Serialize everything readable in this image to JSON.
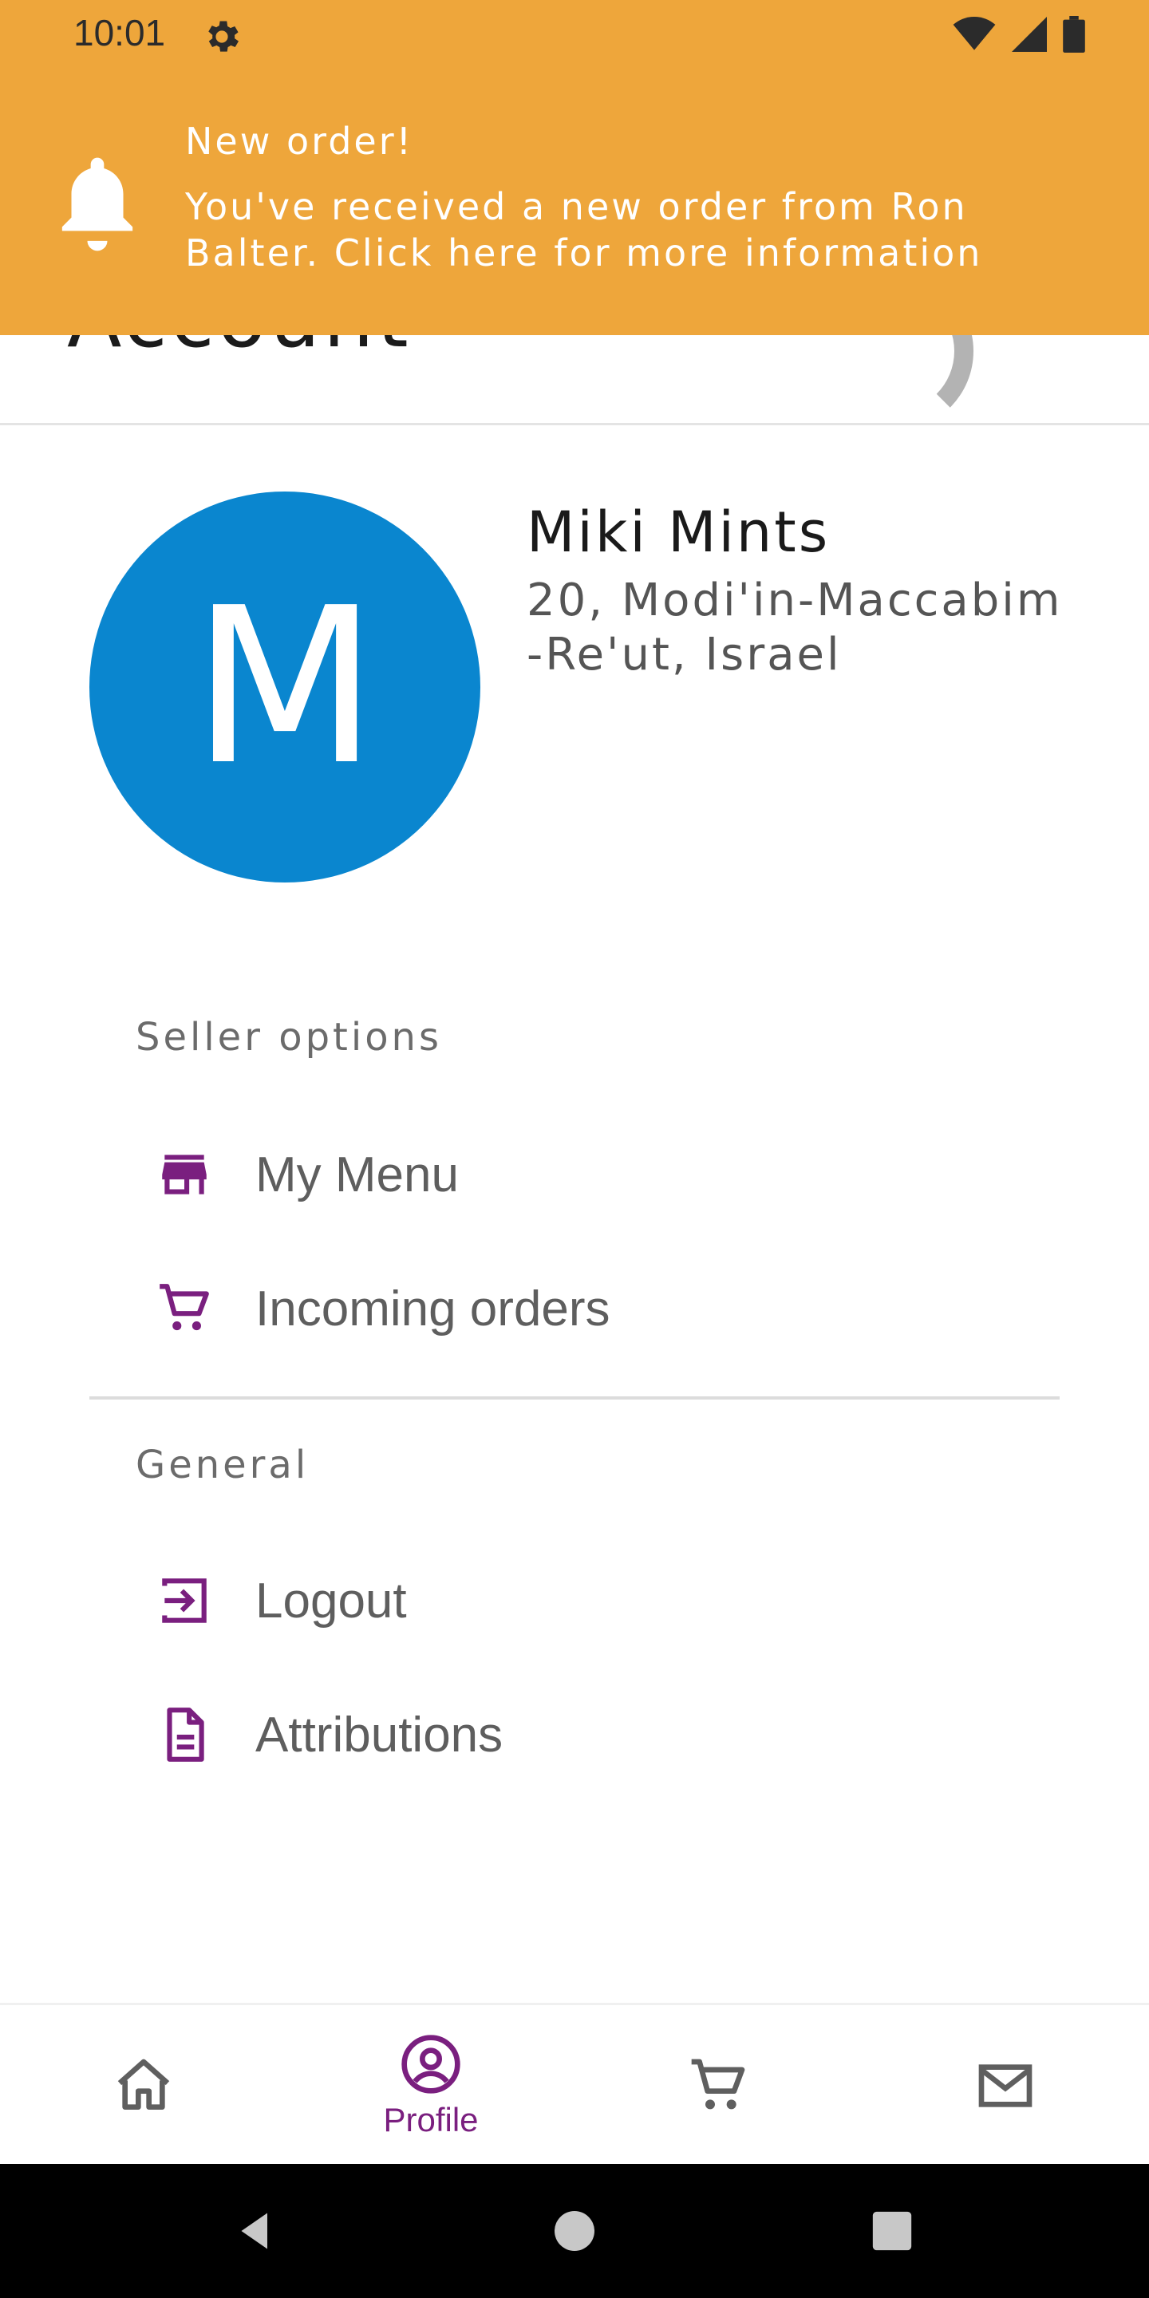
{
  "status_bar": {
    "time": "10:01",
    "icons": [
      "gear-icon",
      "wifi-icon",
      "signal-icon",
      "battery-icon"
    ]
  },
  "notification": {
    "title": "New order!",
    "body": "You've received a new order from Ron Balter. Click here for more information",
    "icon": "bell-icon",
    "background_color": "#eea63b"
  },
  "header": {
    "title": "Account"
  },
  "profile": {
    "initial": "M",
    "name": "Miki Mints",
    "address": "20, Modi'in-Maccabim-Re'ut, Israel",
    "avatar_color": "#0a86cf"
  },
  "seller_section": {
    "title": "Seller options",
    "items": [
      {
        "label": "My Menu",
        "icon": "store-icon"
      },
      {
        "label": "Incoming orders",
        "icon": "cart-icon"
      }
    ]
  },
  "general_section": {
    "title": "General",
    "items": [
      {
        "label": "Logout",
        "icon": "logout-icon"
      },
      {
        "label": "Attributions",
        "icon": "document-icon"
      }
    ]
  },
  "bottom_nav": {
    "items": [
      {
        "id": "home",
        "icon": "home-icon",
        "label": ""
      },
      {
        "id": "profile",
        "icon": "profile-icon",
        "label": "Profile",
        "active": true
      },
      {
        "id": "cart",
        "icon": "cart-icon",
        "label": ""
      },
      {
        "id": "messages",
        "icon": "mail-icon",
        "label": ""
      }
    ],
    "active_color": "#7a1f7f"
  }
}
